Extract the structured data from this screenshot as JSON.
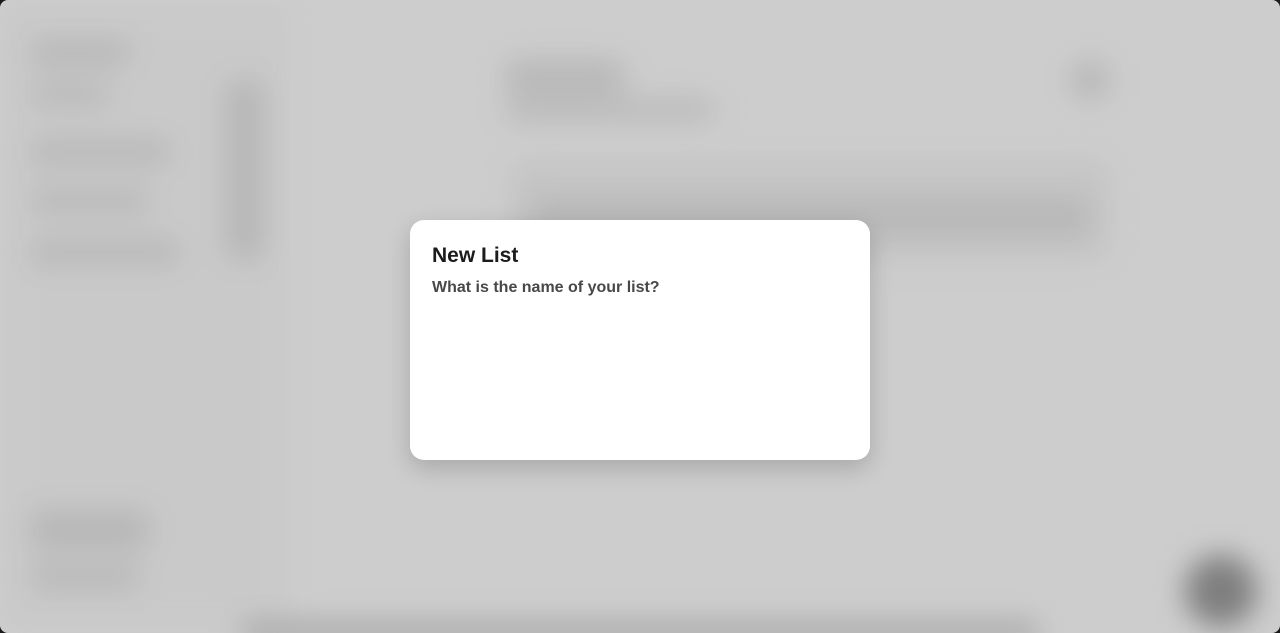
{
  "dialog": {
    "title": "New List",
    "subtitle": "What is the name of your list?",
    "input_value": "",
    "input_placeholder": ""
  },
  "colors": {
    "backdrop": "#cfcfcf",
    "dialog_bg": "#ffffff",
    "title": "#1c1c1e",
    "subtitle": "#48484a"
  }
}
